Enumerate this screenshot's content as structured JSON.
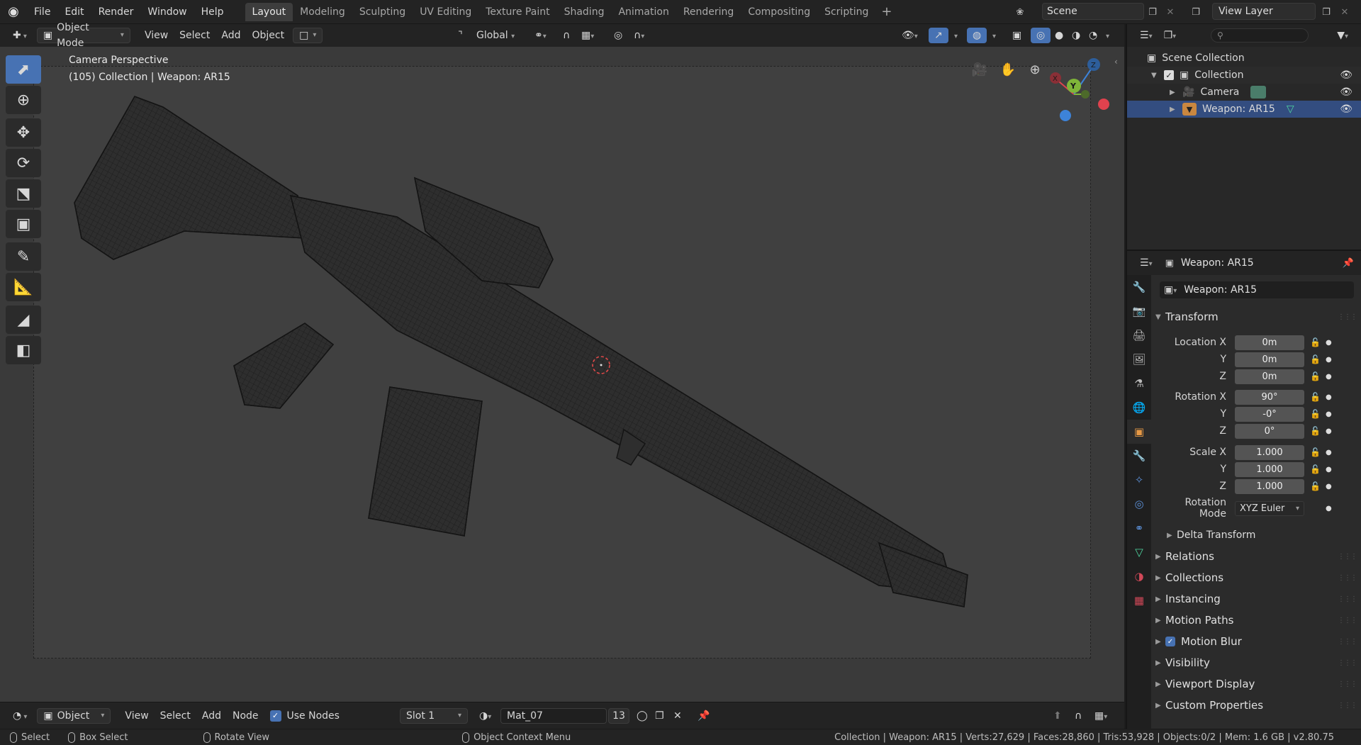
{
  "menu": [
    "File",
    "Edit",
    "Render",
    "Window",
    "Help"
  ],
  "workspaces": [
    "Layout",
    "Modeling",
    "Sculpting",
    "UV Editing",
    "Texture Paint",
    "Shading",
    "Animation",
    "Rendering",
    "Compositing",
    "Scripting"
  ],
  "active_workspace": "Layout",
  "scene_name": "Scene",
  "view_layer_name": "View Layer",
  "viewport_header": {
    "mode": "Object Mode",
    "menus": [
      "View",
      "Select",
      "Add",
      "Object"
    ],
    "orientation": "Global"
  },
  "viewport": {
    "overlay_line1": "Camera Perspective",
    "overlay_line2": "(105) Collection | Weapon: AR15",
    "gizmo_labels": {
      "x": "X",
      "y": "Y",
      "z": "Z"
    }
  },
  "outliner": {
    "root": "Scene Collection",
    "collection": "Collection",
    "items": [
      "Camera",
      "Weapon: AR15"
    ]
  },
  "properties": {
    "header_object": "Weapon: AR15",
    "object_name": "Weapon: AR15",
    "transform_title": "Transform",
    "location_label": "Location X",
    "rotation_label": "Rotation X",
    "scale_label": "Scale X",
    "axis_y": "Y",
    "axis_z": "Z",
    "location": [
      "0m",
      "0m",
      "0m"
    ],
    "rotation": [
      "90°",
      "-0°",
      "0°"
    ],
    "scale": [
      "1.000",
      "1.000",
      "1.000"
    ],
    "rotation_mode_label": "Rotation Mode",
    "rotation_mode": "XYZ Euler",
    "delta_transform": "Delta Transform",
    "panels": [
      "Relations",
      "Collections",
      "Instancing",
      "Motion Paths",
      "Motion Blur",
      "Visibility",
      "Viewport Display",
      "Custom Properties"
    ]
  },
  "node_header": {
    "editor_type": "Object",
    "menus": [
      "View",
      "Select",
      "Add",
      "Node"
    ],
    "use_nodes": "Use Nodes",
    "slot": "Slot 1",
    "material": "Mat_07",
    "users": "13"
  },
  "statusbar": {
    "select": "Select",
    "box_select": "Box Select",
    "rotate_view": "Rotate View",
    "context_menu": "Object Context Menu",
    "stats": "Collection | Weapon: AR15 | Verts:27,629 | Faces:28,860 | Tris:53,928 | Objects:0/2 | Mem: 1.6 GB | v2.80.75"
  },
  "colors": {
    "accent": "#4772b3",
    "selected_row": "#334d80",
    "axis_x": "#e0424e",
    "axis_y": "#7fb539",
    "axis_z": "#3d83d9"
  }
}
